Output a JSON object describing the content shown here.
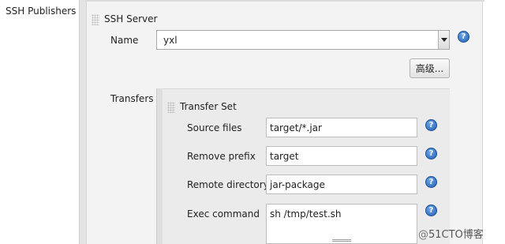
{
  "left_label": "SSH Publishers",
  "server": {
    "title": "SSH Server",
    "name_label": "Name",
    "name_value": "yxl",
    "advanced_button": "高级..."
  },
  "transfers": {
    "label": "Transfers",
    "set_title": "Transfer Set",
    "source_files_label": "Source files",
    "source_files_value": "target/*.jar",
    "remove_prefix_label": "Remove prefix",
    "remove_prefix_value": "target",
    "remote_directory_label": "Remote directory",
    "remote_directory_value": "jar-package",
    "exec_command_label": "Exec command",
    "exec_command_value": "sh /tmp/test.sh"
  },
  "help_glyph": "?",
  "watermark": {
    "at": "@",
    "text": "51CTO博客"
  },
  "icons": {
    "help": "help-icon",
    "grip": "drag-handle-icon",
    "dropdown": "chevron-down-icon"
  },
  "colors": {
    "help_blue": "#1f5fb4",
    "panel_grey": "#f3f3f3",
    "inner_panel_grey": "#ebebeb"
  }
}
